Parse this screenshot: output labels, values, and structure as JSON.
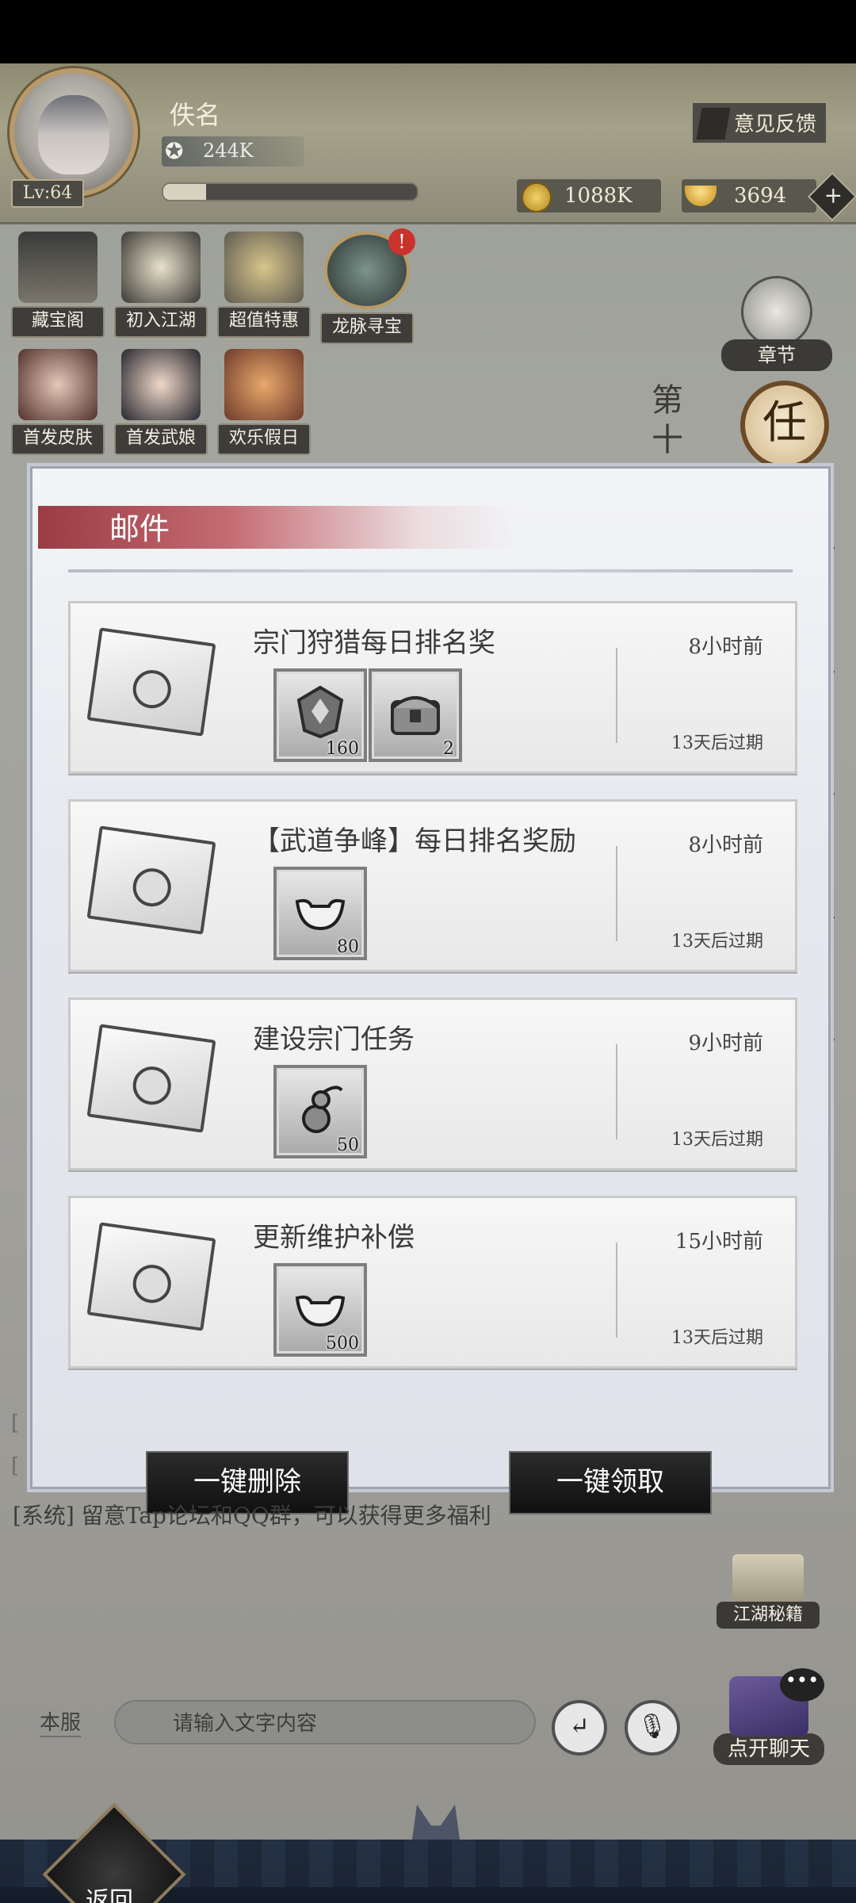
{
  "header": {
    "player_name": "佚名",
    "level": "Lv:64",
    "power": "244K",
    "exp_progress": 0.17,
    "feedback_label": "意见反馈",
    "copper": "1088K",
    "gold": "3694"
  },
  "activities": [
    {
      "label": "藏宝阁"
    },
    {
      "label": "初入江湖"
    },
    {
      "label": "超值特惠"
    },
    {
      "label": "龙脉寻宝"
    },
    {
      "label": "首发皮肤"
    },
    {
      "label": "首发武娘"
    },
    {
      "label": "欢乐假日"
    }
  ],
  "right": {
    "chapter_label": "章节",
    "task_glyph": "任",
    "vertical_text": "第十"
  },
  "mail": {
    "title": "邮件",
    "items": [
      {
        "title": "宗门狩猎每日排名奖",
        "time": "8小时前",
        "expire": "13天后过期",
        "rewards": [
          {
            "icon": "shield-badge-icon",
            "count": "160"
          },
          {
            "icon": "treasure-chest-icon",
            "count": "2"
          }
        ]
      },
      {
        "title": "【武道争峰】每日排名奖励",
        "time": "8小时前",
        "expire": "13天后过期",
        "rewards": [
          {
            "icon": "ingot-icon",
            "count": "80"
          }
        ]
      },
      {
        "title": "建设宗门任务",
        "time": "9小时前",
        "expire": "13天后过期",
        "rewards": [
          {
            "icon": "gourd-icon",
            "count": "50"
          }
        ]
      },
      {
        "title": "更新维护补偿",
        "time": "15小时前",
        "expire": "13天后过期",
        "rewards": [
          {
            "icon": "ingot-icon",
            "count": "500"
          }
        ]
      }
    ],
    "delete_all": "一键删除",
    "claim_all": "一键领取"
  },
  "chat": {
    "system_line": "[系统] 留意Tap论坛和QQ群，可以获得更多福利",
    "mini_lines": [
      "[",
      "["
    ],
    "server_tab": "本服",
    "placeholder": "请输入文字内容",
    "enter_glyph": "↵",
    "mic_glyph": "🎙",
    "jianghu_label": "江湖秘籍",
    "open_chat_label": "点开聊天",
    "bubble": "•••"
  },
  "footer": {
    "back_label": "返回"
  },
  "colors": {
    "accent_red": "#9b3b44",
    "panel_bg": "#e6e8ee",
    "button_dark": "#1c1c1c"
  }
}
